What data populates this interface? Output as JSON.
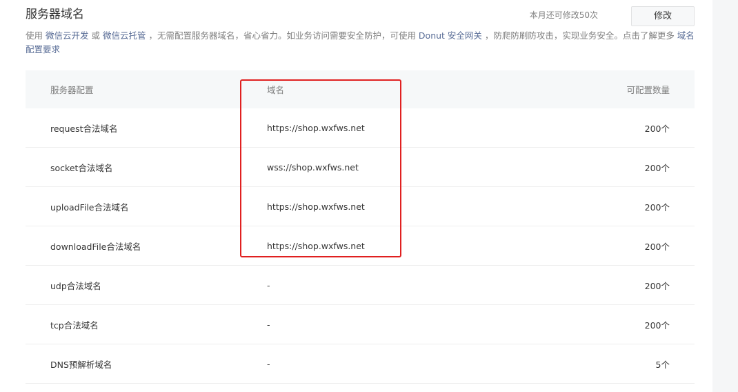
{
  "header": {
    "title": "服务器域名",
    "remaining_text": "本月还可修改50次",
    "edit_label": "修改"
  },
  "description": {
    "p1": "使用 ",
    "link1": "微信云开发",
    "p2": " 或 ",
    "link2": "微信云托管",
    "p3": " ，无需配置服务器域名，省心省力。如业务访问需要安全防护，可使用 ",
    "link3": "Donut 安全网关",
    "p4": " ，防爬防刷防攻击，实现业务安全。点击了解更多 ",
    "link4": "域名配置要求"
  },
  "table": {
    "headers": [
      "服务器配置",
      "域名",
      "可配置数量"
    ],
    "rows": [
      {
        "config": "request合法域名",
        "domain": "https://shop.wxfws.net",
        "count": "200个"
      },
      {
        "config": "socket合法域名",
        "domain": "wss://shop.wxfws.net",
        "count": "200个"
      },
      {
        "config": "uploadFile合法域名",
        "domain": "https://shop.wxfws.net",
        "count": "200个"
      },
      {
        "config": "downloadFile合法域名",
        "domain": "https://shop.wxfws.net",
        "count": "200个"
      },
      {
        "config": "udp合法域名",
        "domain": "-",
        "count": "200个"
      },
      {
        "config": "tcp合法域名",
        "domain": "-",
        "count": "200个"
      },
      {
        "config": "DNS预解析域名",
        "domain": "-",
        "count": "5个"
      }
    ]
  },
  "colors": {
    "link": "#576b95",
    "highlight_border": "#e02020"
  }
}
